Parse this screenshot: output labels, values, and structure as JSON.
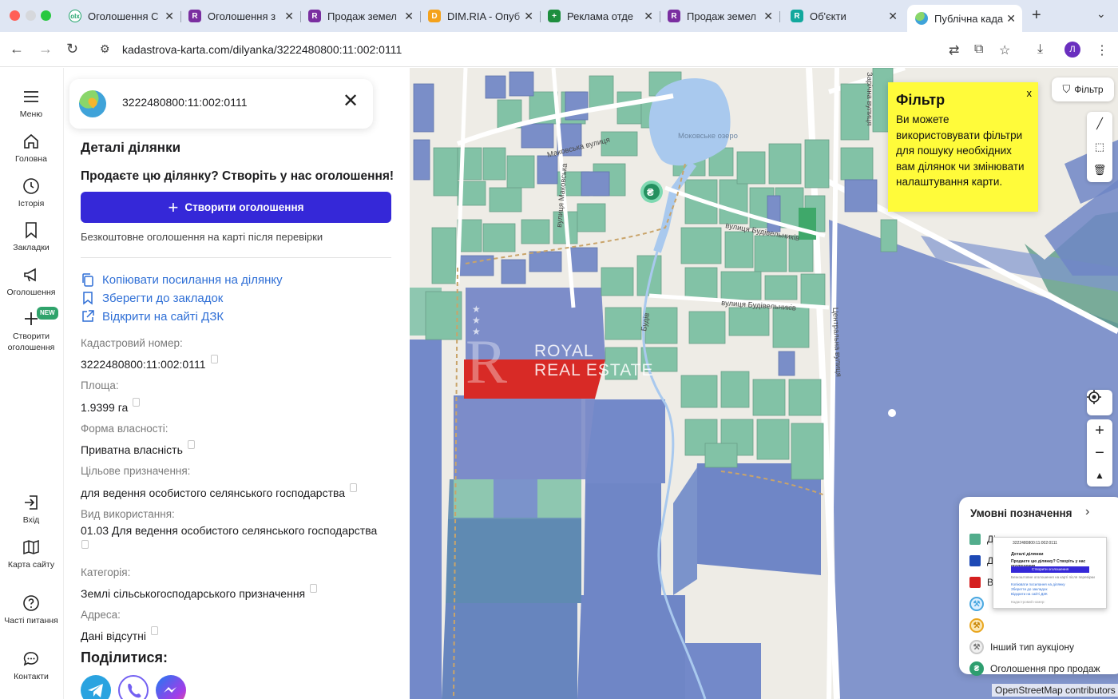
{
  "browser": {
    "tabs": [
      {
        "title": "Оголошення С",
        "fav_color": "#1fa36a",
        "fav_text": "olx"
      },
      {
        "title": "Оголошення з",
        "fav_color": "#7a2ea0",
        "fav_text": "R"
      },
      {
        "title": "Продаж земел",
        "fav_color": "#7a2ea0",
        "fav_text": "R"
      },
      {
        "title": "DIM.RIA - Опуб",
        "fav_color": "#f4a21c",
        "fav_text": "D"
      },
      {
        "title": "Реклама отде",
        "fav_color": "#1e8e3e",
        "fav_text": "+"
      },
      {
        "title": "Продаж земел",
        "fav_color": "#7a2ea0",
        "fav_text": "R"
      },
      {
        "title": "Об'єкти",
        "fav_color": "#12a89d",
        "fav_text": "R"
      },
      {
        "title": "Публічна када",
        "fav_color": "#4aa8e0",
        "fav_text": ""
      }
    ],
    "url": "kadastrova-karta.com/dilyanka/3222480800:11:002:0111",
    "profile_initial": "Л"
  },
  "rail": {
    "items": [
      {
        "label": "Меню",
        "icon": "hamburger-icon"
      },
      {
        "label": "Головна",
        "icon": "home-icon"
      },
      {
        "label": "Історія",
        "icon": "clock-icon"
      },
      {
        "label": "Закладки",
        "icon": "bookmark-icon"
      },
      {
        "label": "Оголошення",
        "icon": "megaphone-icon"
      },
      {
        "label": "Створити оголошення",
        "icon": "plus-icon",
        "badge": "NEW"
      },
      {
        "label": "Вхід",
        "icon": "login-icon"
      },
      {
        "label": "Карта сайту",
        "icon": "map-icon"
      },
      {
        "label": "Часті питання",
        "icon": "question-icon"
      },
      {
        "label": "Контакти",
        "icon": "chat-icon"
      }
    ]
  },
  "panel": {
    "search_value": "3222480800:11:002:0111",
    "title": "Деталі ділянки",
    "sell_prompt": "Продаєте цю ділянку? Створіть у нас оголошення!",
    "create_button": "Створити оголошення",
    "free_note": "Безкоштовне оголошення на карті після перевірки",
    "links": {
      "copy": "Копіювати посилання на ділянку",
      "bookmark": "Зберегти до закладок",
      "dzk": "Відкрити на сайті ДЗК"
    },
    "fields": {
      "cadastral_label": "Кадастровий номер:",
      "cadastral_value": "3222480800:11:002:0111",
      "area_label": "Площа:",
      "area_value": "1.9399 га",
      "ownership_label": "Форма власності:",
      "ownership_value": "Приватна власність",
      "purpose_label": "Цільове призначення:",
      "purpose_value": "для ведення особистого селянського господарства",
      "usage_label": "Вид використання:",
      "usage_value": "01.03 Для ведення особистого селянського господарства",
      "category_label": "Категорія:",
      "category_value": "Землі сільськогосподарського призначення",
      "address_label": "Адреса:",
      "address_value": "Дані відсутні"
    },
    "share_title": "Поділитися:",
    "share_services": [
      {
        "name": "telegram-icon",
        "color": "#2aa3e0"
      },
      {
        "name": "viber-icon",
        "color": "#7360f2"
      },
      {
        "name": "messenger-icon",
        "color": "#1e7bf2"
      }
    ]
  },
  "map": {
    "filter_button": "Фільтр",
    "filter_popup": {
      "title": "Фільтр",
      "text": "Ви можете використовувати фільтри для пошуку необхідних вам ділянок чи змінювати налаштування карти.",
      "close": "x"
    },
    "street_labels": [
      "Маковська вулиця",
      "вулиця Маковська",
      "вулиця Будівельників",
      "вулиця Будівельників",
      "Центральна вулиця",
      "Зарічна вулиця",
      "Моковське озеро",
      "Будів"
    ],
    "watermark": {
      "line1": "ROYAL",
      "line2": "REAL ESTATE",
      "stars": "★ ★ ★"
    },
    "legend": {
      "title": "Умовні позначення",
      "items": [
        {
          "label": "Ділянка з адресою",
          "color": "#52ad8c",
          "kind": "swatch"
        },
        {
          "label": "Д",
          "color": "#1d49b5",
          "kind": "swatch"
        },
        {
          "label": "В",
          "color": "#d51f1f",
          "kind": "swatch"
        },
        {
          "label": "",
          "color": "#4aa8e0",
          "kind": "circle"
        },
        {
          "label": "",
          "color": "#e9a61f",
          "kind": "circle"
        },
        {
          "label": "Інший тип аукціону",
          "color": "#c9c9c9",
          "kind": "circle"
        },
        {
          "label": "Оголошення про продаж",
          "color": "#2e9e6f",
          "kind": "circle",
          "symbol": "₴"
        }
      ]
    },
    "mini_preview": {
      "search": "3222480800:11:002:0111",
      "title": "Деталі ділянки",
      "sell": "Продаєте цю ділянку? Створіть у нас оголошення",
      "button": "Створити оголошення",
      "note": "Безкоштовне оголошення на карті після перевірки",
      "links": [
        "Копіювати посилання на ділянку",
        "Зберегти до закладок",
        "Відкрити на сайті ДЗК"
      ],
      "field_label": "Кадастровий номер:"
    },
    "hryvnia_marker": "₴",
    "attribution": "OpenStreetMap contributors"
  }
}
